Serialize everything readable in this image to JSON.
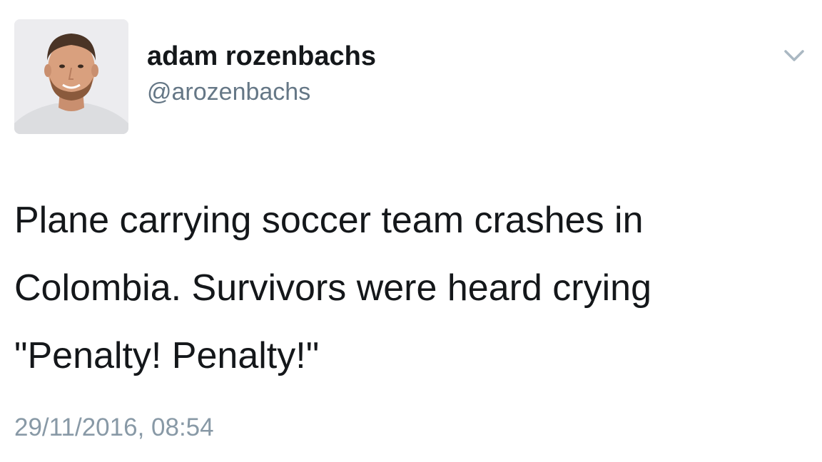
{
  "tweet": {
    "author": {
      "display_name": "adam rozenbachs",
      "handle": "@arozenbachs",
      "avatar_icon": "profile-photo"
    },
    "menu_icon": "chevron-down-icon",
    "text_lines": [
      "Plane carrying soccer team crashes in",
      "Colombia. Survivors were heard crying",
      "\"Penalty! Penalty!\""
    ],
    "timestamp": "29/11/2016, 08:54"
  }
}
